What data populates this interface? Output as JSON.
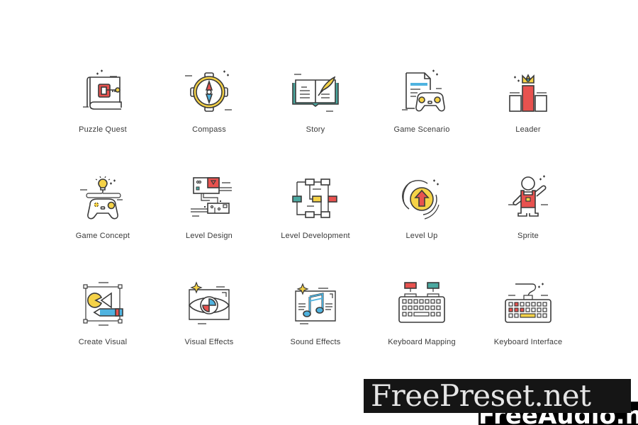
{
  "colors": {
    "outline": "#3a3a3a",
    "red": "#e8524f",
    "yellow": "#f5d247",
    "teal": "#4aa8a0",
    "blue": "#4fb3e0"
  },
  "icons": [
    {
      "label": "Puzzle Quest",
      "icon": "puzzle-quest-icon"
    },
    {
      "label": "Compass",
      "icon": "compass-icon"
    },
    {
      "label": "Story",
      "icon": "story-book-icon"
    },
    {
      "label": "Game Scenario",
      "icon": "game-scenario-icon"
    },
    {
      "label": "Leader",
      "icon": "leader-podium-icon"
    },
    {
      "label": "Game Concept",
      "icon": "game-concept-icon"
    },
    {
      "label": "Level Design",
      "icon": "level-design-icon"
    },
    {
      "label": "Level Development",
      "icon": "level-development-icon"
    },
    {
      "label": "Level Up",
      "icon": "level-up-icon"
    },
    {
      "label": "Sprite",
      "icon": "sprite-icon"
    },
    {
      "label": "Create Visual",
      "icon": "create-visual-icon"
    },
    {
      "label": "Visual Effects",
      "icon": "visual-effects-icon"
    },
    {
      "label": "Sound Effects",
      "icon": "sound-effects-icon"
    },
    {
      "label": "Keyboard Mapping",
      "icon": "keyboard-mapping-icon"
    },
    {
      "label": "Keyboard Interface",
      "icon": "keyboard-interface-icon"
    }
  ],
  "watermark": {
    "primary": "FreePreset.net",
    "secondary": "FreeAudio.net"
  }
}
